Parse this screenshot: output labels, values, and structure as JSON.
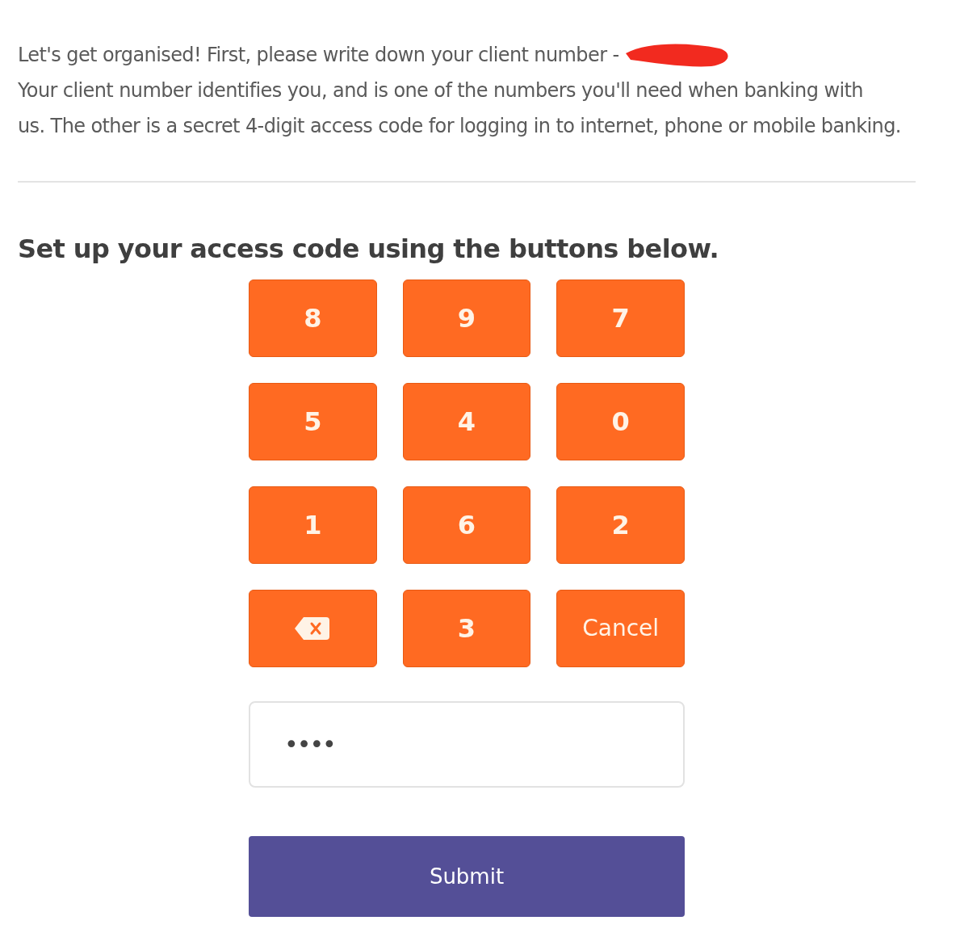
{
  "intro": {
    "lines": [
      "Let's get organised! First, please write down your client number -",
      "Your client number identifies you, and is one of the numbers you'll need when banking with",
      "us. The other is a secret 4-digit access code for logging in to internet, phone or mobile banking."
    ],
    "redacted": true
  },
  "heading": "Set up your access code using the buttons below.",
  "keypad": [
    {
      "kind": "digit",
      "label": "8"
    },
    {
      "kind": "digit",
      "label": "9"
    },
    {
      "kind": "digit",
      "label": "7"
    },
    {
      "kind": "digit",
      "label": "5"
    },
    {
      "kind": "digit",
      "label": "4"
    },
    {
      "kind": "digit",
      "label": "0"
    },
    {
      "kind": "digit",
      "label": "1"
    },
    {
      "kind": "digit",
      "label": "6"
    },
    {
      "kind": "digit",
      "label": "2"
    },
    {
      "kind": "backspace"
    },
    {
      "kind": "digit",
      "label": "3"
    },
    {
      "kind": "text",
      "label": "Cancel"
    }
  ],
  "code_field": {
    "value": "••••"
  },
  "submit": "Submit"
}
